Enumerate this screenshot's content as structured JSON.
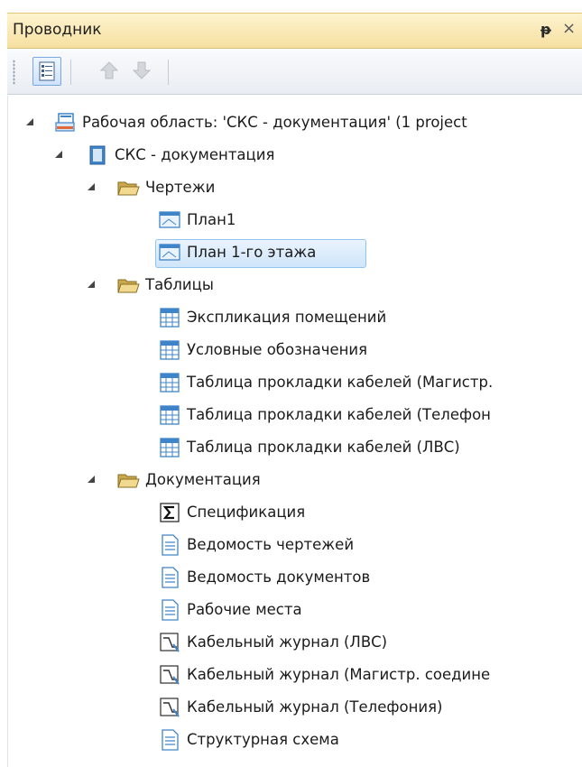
{
  "panel": {
    "title": "Проводник",
    "pin_glyph": "ᵽ",
    "close_glyph": "×"
  },
  "toolbar": {
    "buttons": [
      {
        "icon": "properties-icon",
        "state": "active"
      },
      {
        "icon": "arrow-up-icon",
        "state": "disabled"
      },
      {
        "icon": "arrow-down-icon",
        "state": "disabled"
      }
    ]
  },
  "tree": {
    "workspace": "Рабочая область: 'СКС - документация' (1 project",
    "project": "СКС - документация",
    "folders": [
      {
        "label": "Чертежи",
        "items": [
          {
            "label": "План1",
            "icon": "drawing-icon",
            "selected": false
          },
          {
            "label": "План 1-го этажа",
            "icon": "drawing-icon",
            "selected": true
          }
        ]
      },
      {
        "label": "Таблицы",
        "items": [
          {
            "label": "Экспликация помещений",
            "icon": "table-icon"
          },
          {
            "label": "Условные обозначения",
            "icon": "table-icon"
          },
          {
            "label": "Таблица прокладки кабелей (Магистр.",
            "icon": "table-icon"
          },
          {
            "label": "Таблица прокладки кабелей (Телефон",
            "icon": "table-icon"
          },
          {
            "label": "Таблица прокладки кабелей (ЛВС)",
            "icon": "table-icon"
          }
        ]
      },
      {
        "label": "Документация",
        "items": [
          {
            "label": "Спецификация",
            "icon": "sigma-icon"
          },
          {
            "label": "Ведомость чертежей",
            "icon": "document-icon"
          },
          {
            "label": "Ведомость документов",
            "icon": "document-icon"
          },
          {
            "label": "Рабочие места",
            "icon": "document-icon"
          },
          {
            "label": "Кабельный журнал (ЛВС)",
            "icon": "cable-journal-icon"
          },
          {
            "label": "Кабельный журнал (Магистр. соедине",
            "icon": "cable-journal-icon"
          },
          {
            "label": "Кабельный журнал (Телефония)",
            "icon": "cable-journal-icon"
          },
          {
            "label": "Структурная схема",
            "icon": "document-icon"
          }
        ]
      }
    ]
  },
  "colors": {
    "title_bar": "#f6e0a0",
    "selection": "#cfe6fb",
    "selection_border": "#8ec2ee",
    "folder": "#e8c874",
    "icon_blue": "#3f84c8"
  }
}
